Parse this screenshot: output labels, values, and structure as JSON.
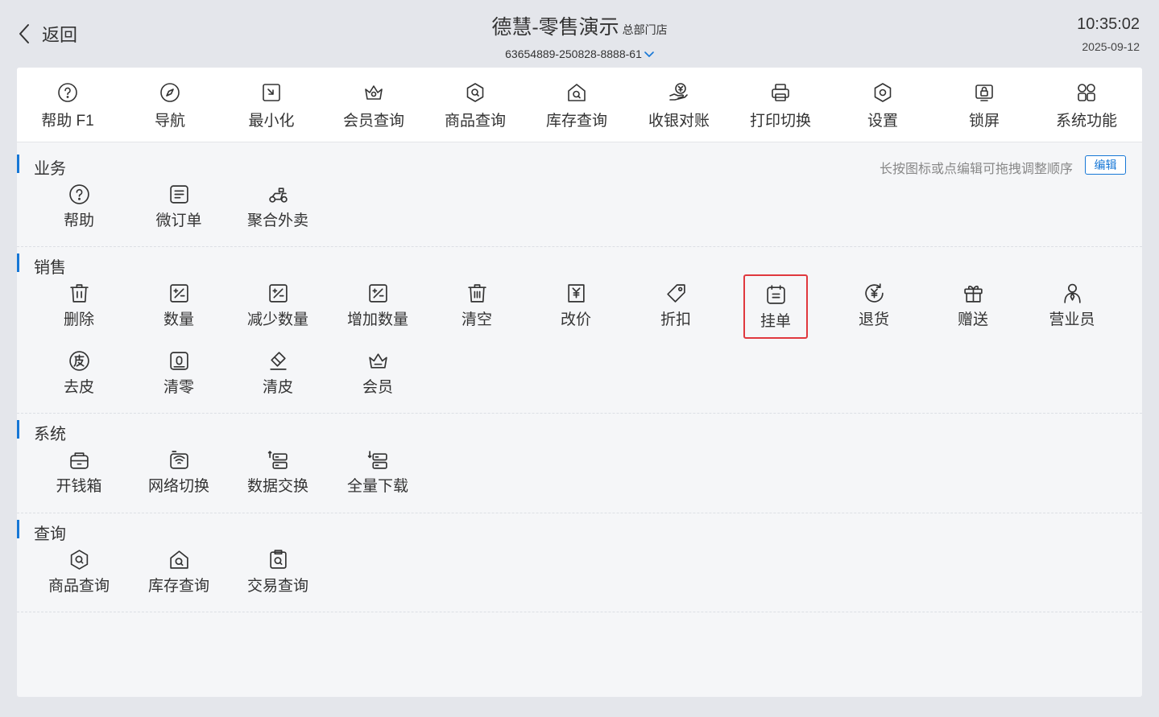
{
  "header": {
    "back_label": "返回",
    "title": "德慧-零售演示",
    "store_tag": "总部门店",
    "device_id": "63654889-250828-8888-61",
    "time": "10:35:02",
    "date": "2025-09-12"
  },
  "toolbar": {
    "items": [
      {
        "label": "帮助 F1",
        "icon": "help-icon"
      },
      {
        "label": "导航",
        "icon": "compass-icon"
      },
      {
        "label": "最小化",
        "icon": "minimize-icon"
      },
      {
        "label": "会员查询",
        "icon": "crown-search-icon"
      },
      {
        "label": "商品查询",
        "icon": "product-search-icon"
      },
      {
        "label": "库存查询",
        "icon": "stock-search-icon"
      },
      {
        "label": "收银对账",
        "icon": "cash-reconcile-icon"
      },
      {
        "label": "打印切换",
        "icon": "printer-icon"
      },
      {
        "label": "设置",
        "icon": "settings-icon"
      },
      {
        "label": "锁屏",
        "icon": "lock-screen-icon"
      },
      {
        "label": "系统功能",
        "icon": "grid-apps-icon"
      }
    ]
  },
  "sections": {
    "business": {
      "title": "业务",
      "hint": "长按图标或点编辑可拖拽调整顺序",
      "edit_label": "编辑",
      "items": [
        {
          "label": "帮助",
          "icon": "help-icon"
        },
        {
          "label": "微订单",
          "icon": "micro-order-icon"
        },
        {
          "label": "聚合外卖",
          "icon": "delivery-scooter-icon"
        }
      ]
    },
    "sales": {
      "title": "销售",
      "items": [
        {
          "label": "删除",
          "icon": "trash-icon"
        },
        {
          "label": "数量",
          "icon": "quantity-icon"
        },
        {
          "label": "减少数量",
          "icon": "decrease-quantity-icon"
        },
        {
          "label": "增加数量",
          "icon": "increase-quantity-icon"
        },
        {
          "label": "清空",
          "icon": "clear-trash-icon"
        },
        {
          "label": "改价",
          "icon": "change-price-icon"
        },
        {
          "label": "折扣",
          "icon": "discount-tag-icon"
        },
        {
          "label": "挂单",
          "icon": "hold-order-icon"
        },
        {
          "label": "退货",
          "icon": "return-goods-icon"
        },
        {
          "label": "赠送",
          "icon": "gift-icon"
        },
        {
          "label": "营业员",
          "icon": "clerk-icon"
        },
        {
          "label": "去皮",
          "icon": "tare-icon"
        },
        {
          "label": "清零",
          "icon": "zero-scale-icon"
        },
        {
          "label": "清皮",
          "icon": "eraser-icon"
        },
        {
          "label": "会员",
          "icon": "crown-icon"
        }
      ]
    },
    "system": {
      "title": "系统",
      "items": [
        {
          "label": "开钱箱",
          "icon": "cash-drawer-icon"
        },
        {
          "label": "网络切换",
          "icon": "network-switch-icon"
        },
        {
          "label": "数据交换",
          "icon": "data-exchange-icon"
        },
        {
          "label": "全量下载",
          "icon": "full-download-icon"
        }
      ]
    },
    "query": {
      "title": "查询",
      "items": [
        {
          "label": "商品查询",
          "icon": "product-search-icon"
        },
        {
          "label": "库存查询",
          "icon": "stock-search-icon"
        },
        {
          "label": "交易查询",
          "icon": "transaction-search-icon"
        }
      ]
    }
  },
  "colors": {
    "accent": "#1677d6",
    "highlight_border": "#e0383e",
    "background": "#e4e6eb",
    "panel": "#f5f6f8"
  }
}
